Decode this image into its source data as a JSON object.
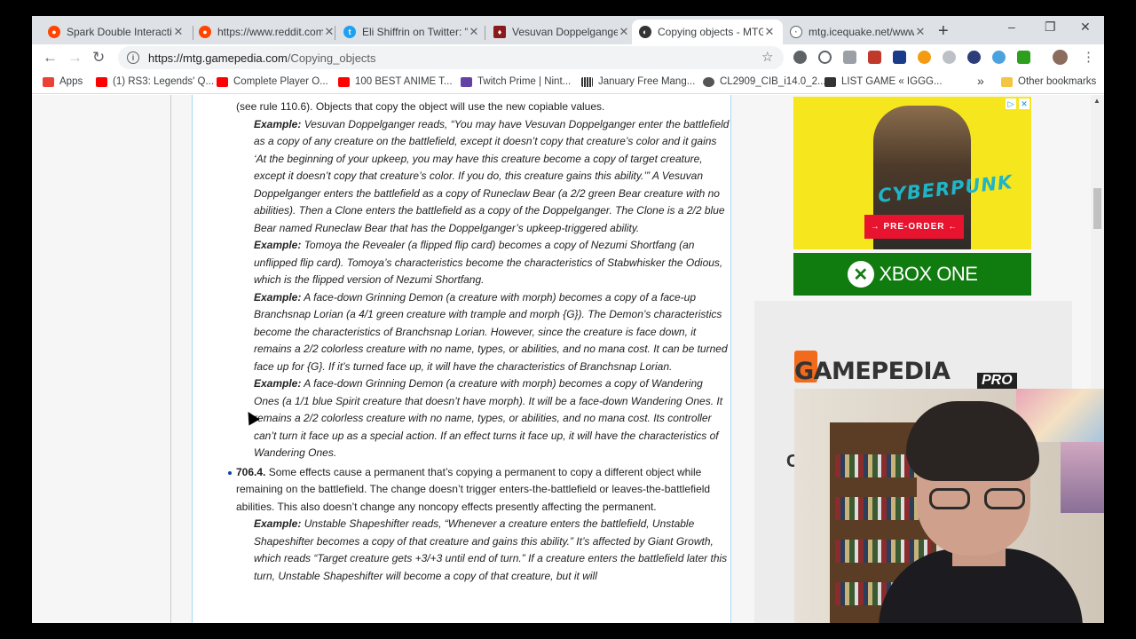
{
  "browser": {
    "tabs": [
      {
        "title": "Spark Double Interactio",
        "favicon_color": "#ff4500",
        "active": false
      },
      {
        "title": "https://www.reddit.com",
        "favicon_color": "#ff4500",
        "active": false
      },
      {
        "title": "Eli Shiffrin on Twitter: \"V",
        "favicon_color": "#1da1f2",
        "active": false
      },
      {
        "title": "Vesuvan Doppelganger",
        "favicon_color": "#8b1a1a",
        "active": false
      },
      {
        "title": "Copying objects - MTG",
        "favicon_color": "#333333",
        "active": true
      },
      {
        "title": "mtg.icequake.net/www/",
        "favicon_color": "#5f6368",
        "active": false
      }
    ],
    "new_tab_label": "+",
    "window_controls": {
      "minimize": "–",
      "restore": "❐",
      "close": "✕"
    },
    "url_host": "https://mtg.gamepedia.com",
    "url_path": "/Copying_objects",
    "bookmarks": [
      {
        "label": "Apps",
        "color": "#ea4335"
      },
      {
        "label": "(1) RS3: Legends' Q...",
        "color": "#ff0000"
      },
      {
        "label": "Complete Player O...",
        "color": "#ff0000"
      },
      {
        "label": "100 BEST ANIME T...",
        "color": "#ff0000"
      },
      {
        "label": "Twitch Prime | Nint...",
        "color": "#6441a5"
      },
      {
        "label": "January Free Mang...",
        "color": "#333333"
      },
      {
        "label": "CL2909_CIB_i14.0_2...",
        "color": "#555555"
      },
      {
        "label": "LIST GAME « IGGG...",
        "color": "#333333"
      }
    ],
    "bookmarks_overflow": "»",
    "other_bookmarks": "Other bookmarks"
  },
  "article": {
    "intro": "(see rule 110.6). Objects that copy the object will use the new copiable values.",
    "examples_a": [
      {
        "label": "Example:",
        "text": " Vesuvan Doppelganger reads, “You may have Vesuvan Doppelganger enter the battlefield as a copy of any creature on the battlefield, except it doesn’t copy that creature’s color and it gains ‘At the beginning of your upkeep, you may have this creature become a copy of target creature, except it doesn’t copy that creature’s color. If you do, this creature gains this ability.’” A Vesuvan Doppelganger enters the battlefield as a copy of Runeclaw Bear (a 2/2 green Bear creature with no abilities). Then a Clone enters the battlefield as a copy of the Doppelganger. The Clone is a 2/2 blue Bear named Runeclaw Bear that has the Doppelganger’s upkeep-triggered ability."
      },
      {
        "label": "Example:",
        "text": " Tomoya the Revealer (a flipped flip card) becomes a copy of Nezumi Shortfang (an unflipped flip card). Tomoya’s characteristics become the characteristics of Stabwhisker the Odious, which is the flipped version of Nezumi Shortfang."
      },
      {
        "label": "Example:",
        "text": " A face-down Grinning Demon (a creature with morph) becomes a copy of a face-up Branchsnap Lorian (a 4/1 green creature with trample and morph {G}). The Demon’s characteristics become the characteristics of Branchsnap Lorian. However, since the creature is face down, it remains a 2/2 colorless creature with no name, types, or abilities, and no mana cost. It can be turned face up for {G}. If it’s turned face up, it will have the characteristics of Branchsnap Lorian."
      },
      {
        "label": "Example:",
        "text": " A face-down Grinning Demon (a creature with morph) becomes a copy of Wandering Ones (a 1/1 blue Spirit creature that doesn’t have morph). It will be a face-down Wandering Ones. It remains a 2/2 colorless creature with no name, types, or abilities, and no mana cost. Its controller can’t turn it face up as a special action. If an effect turns it face up, it will have the characteristics of Wandering Ones."
      }
    ],
    "rule_number": "706.4.",
    "rule_text": " Some effects cause a permanent that’s copying a permanent to copy a different object while remaining on the battlefield. The change doesn’t trigger enters-the-battlefield or leaves-the-battlefield abilities. This also doesn’t change any noncopy effects presently affecting the permanent.",
    "example_b": {
      "label": "Example:",
      "text": " Unstable Shapeshifter reads, “Whenever a creature enters the battlefield, Unstable Shapeshifter becomes a copy of that creature and gains this ability.” It’s affected by Giant Growth, which reads “Target creature gets +3/+3 until end of turn.” If a creature enters the battlefield later this turn, Unstable Shapeshifter will become a copy of that creature, but it will"
    }
  },
  "ad": {
    "logo": "CYBERPUNK",
    "cta": "→ PRE-ORDER ←",
    "platform": "XBOX ONE",
    "adchoices": [
      "▷",
      "✕"
    ]
  },
  "promo": {
    "logo": "GAMEPEDIA",
    "badge": "PRO",
    "fragment": "C"
  }
}
